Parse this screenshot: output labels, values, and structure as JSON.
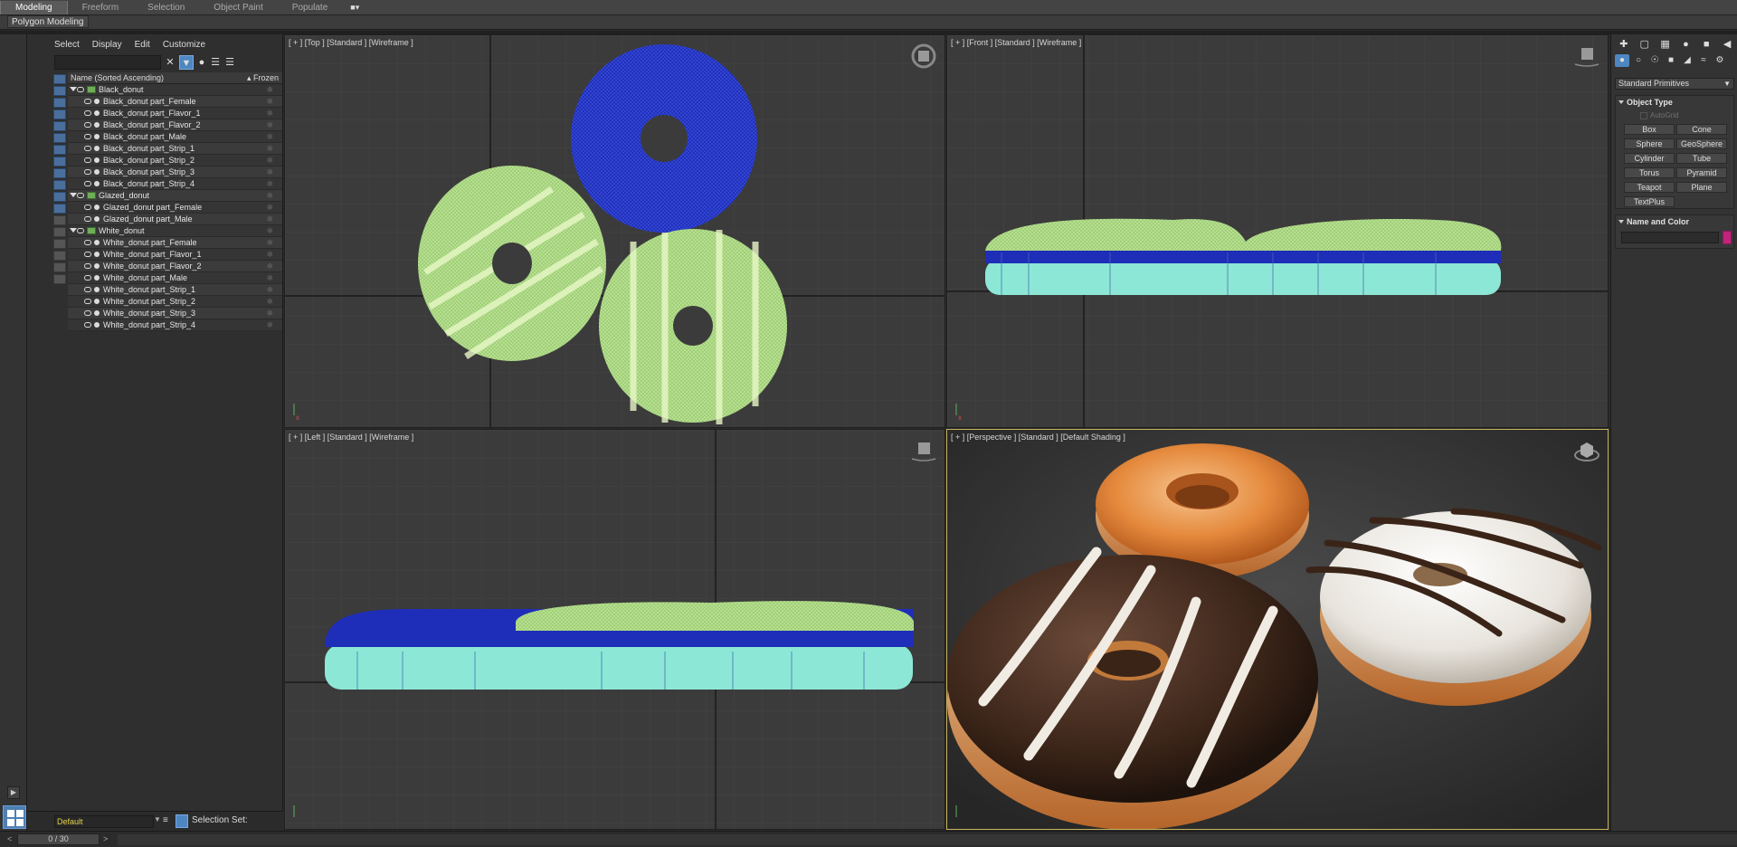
{
  "ribbon": {
    "tabs": [
      "Modeling",
      "Freeform",
      "Selection",
      "Object Paint",
      "Populate"
    ],
    "active_tab": "Modeling",
    "tab_options_icon": "■▾",
    "subpanel": "Polygon Modeling"
  },
  "explorer": {
    "menu": [
      "Select",
      "Display",
      "Edit",
      "Customize"
    ],
    "column_name": "Name (Sorted Ascending)",
    "column_frozen": "▴ Frozen",
    "items": [
      {
        "label": "Black_donut",
        "type": "group"
      },
      {
        "label": "Black_donut part_Female",
        "type": "child"
      },
      {
        "label": "Black_donut part_Flavor_1",
        "type": "child"
      },
      {
        "label": "Black_donut part_Flavor_2",
        "type": "child"
      },
      {
        "label": "Black_donut part_Male",
        "type": "child"
      },
      {
        "label": "Black_donut part_Strip_1",
        "type": "child"
      },
      {
        "label": "Black_donut part_Strip_2",
        "type": "child"
      },
      {
        "label": "Black_donut part_Strip_3",
        "type": "child"
      },
      {
        "label": "Black_donut part_Strip_4",
        "type": "child"
      },
      {
        "label": "Glazed_donut",
        "type": "group"
      },
      {
        "label": "Glazed_donut part_Female",
        "type": "child"
      },
      {
        "label": "Glazed_donut part_Male",
        "type": "child"
      },
      {
        "label": "White_donut",
        "type": "group"
      },
      {
        "label": "White_donut part_Female",
        "type": "child"
      },
      {
        "label": "White_donut part_Flavor_1",
        "type": "child"
      },
      {
        "label": "White_donut part_Flavor_2",
        "type": "child"
      },
      {
        "label": "White_donut part_Male",
        "type": "child"
      },
      {
        "label": "White_donut part_Strip_1",
        "type": "child"
      },
      {
        "label": "White_donut part_Strip_2",
        "type": "child"
      },
      {
        "label": "White_donut part_Strip_3",
        "type": "child"
      },
      {
        "label": "White_donut part_Strip_4",
        "type": "child"
      }
    ],
    "layer": "Default",
    "selection_set_label": "Selection Set:"
  },
  "viewports": {
    "top": "[ + ] [Top ] [Standard ] [Wireframe ]",
    "front": "[ + ] [Front ] [Standard ] [Wireframe ]",
    "left": "[ + ] [Left ] [Standard ] [Wireframe ]",
    "perspective": "[ + ] [Perspective ] [Standard ] [Default Shading ]"
  },
  "command_panel": {
    "category": "Standard Primitives",
    "object_type_title": "Object Type",
    "autogrid": "AutoGrid",
    "buttons": [
      "Box",
      "Cone",
      "Sphere",
      "GeoSphere",
      "Cylinder",
      "Tube",
      "Torus",
      "Pyramid",
      "Teapot",
      "Plane",
      "TextPlus"
    ],
    "name_color_title": "Name and Color",
    "swatch_color": "#c2247c"
  },
  "timeline": {
    "frame": "0 / 30"
  },
  "colors": {
    "wire_green": "#b5e08e",
    "wire_blue": "#1e2eb8",
    "wire_cyan": "#8de7d6",
    "active_border": "#c7b35b"
  }
}
